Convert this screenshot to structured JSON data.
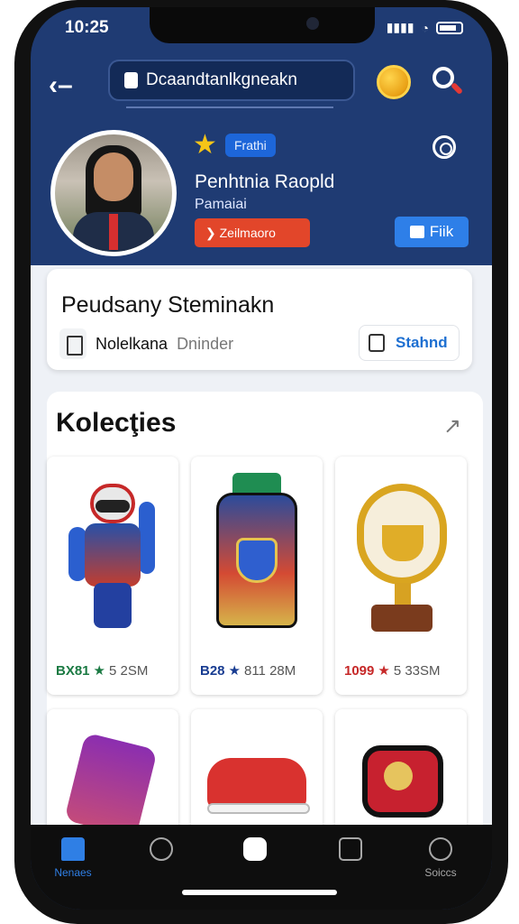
{
  "status_bar": {
    "time": "10:25",
    "signal": "▮▮▮▮"
  },
  "header": {
    "search_text": "Dcaandtanlkgneakn",
    "coin_label": "",
    "icons": [
      "back-icon",
      "bag-icon",
      "coin-icon",
      "search-icon"
    ]
  },
  "profile": {
    "badge": "Frathi",
    "name": "Penhtnia Raopld",
    "subtitle": "Pamaiai",
    "red_button": "❯ Zeilmaoro",
    "blue_button": "Fiik"
  },
  "info": {
    "title": "Peudsany Steminakn",
    "chip_primary": "Nolelkana",
    "chip_secondary": "Dninder",
    "chip_right": "Stahnd"
  },
  "collection": {
    "title": "Kolecţies",
    "items": [
      {
        "price": "BX81",
        "rating": "★",
        "stat": "5 2SM",
        "color": "#1b7a43"
      },
      {
        "price": "B28",
        "rating": "★",
        "stat": "811 28M",
        "color": "#183c91"
      },
      {
        "price": "1099",
        "rating": "★",
        "stat": "5 33SM",
        "color": "#c62828"
      }
    ]
  },
  "nav": {
    "home": "Nenaes",
    "profile": "Soiccs"
  }
}
